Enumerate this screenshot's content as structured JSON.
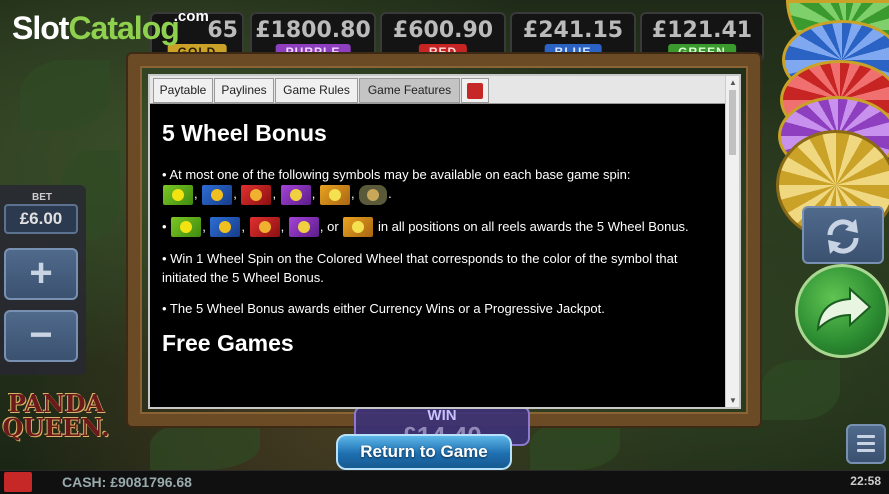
{
  "logo": {
    "slot": "Slot",
    "catalog": "Catalog",
    "com": ".com"
  },
  "jackpots": [
    {
      "amount": "65",
      "label": "GOLD",
      "color": "#c9a227"
    },
    {
      "amount": "£1800.80",
      "label": "PURPLE",
      "color": "#8e3fbf"
    },
    {
      "amount": "£600.90",
      "label": "RED",
      "color": "#c72424"
    },
    {
      "amount": "£241.15",
      "label": "BLUE",
      "color": "#2a63c4"
    },
    {
      "amount": "£121.41",
      "label": "GREEN",
      "color": "#3a9a2d"
    }
  ],
  "close_glyph": "✕",
  "bet": {
    "label": "BET",
    "value": "£6.00",
    "plus": "+",
    "minus": "−"
  },
  "game_logo": {
    "line1": "PANDA",
    "line2": "QUEEN."
  },
  "win": {
    "label": "WIN",
    "value": "£14.40"
  },
  "return_button": "Return to Game",
  "status": {
    "cash": "CASH: £9081796.68",
    "time": "22:58"
  },
  "dialog": {
    "tabs": [
      "Paytable",
      "Paylines",
      "Game Rules",
      "Game Features"
    ],
    "active_tab": "Game Features",
    "sections": {
      "wheel_bonus_title": "5 Wheel Bonus",
      "p1": "• At most one of the following symbols may be available on each base game spin:",
      "p2_prefix": "•",
      "p2_suffix": "in all positions on all reels awards the 5 Wheel Bonus.",
      "p2_or": ", or",
      "p3": "• Win 1 Wheel Spin on the Colored Wheel that corresponds to the color of the symbol that initiated the 5 Wheel Bonus.",
      "p4": "• The 5 Wheel Bonus awards either Currency Wins or a Progressive Jackpot.",
      "free_games_title": "Free Games"
    }
  },
  "colors": {
    "accent_blue": "#1e6fb0",
    "logo_green": "#8fd14f",
    "frame_brown": "#6b4a26"
  }
}
